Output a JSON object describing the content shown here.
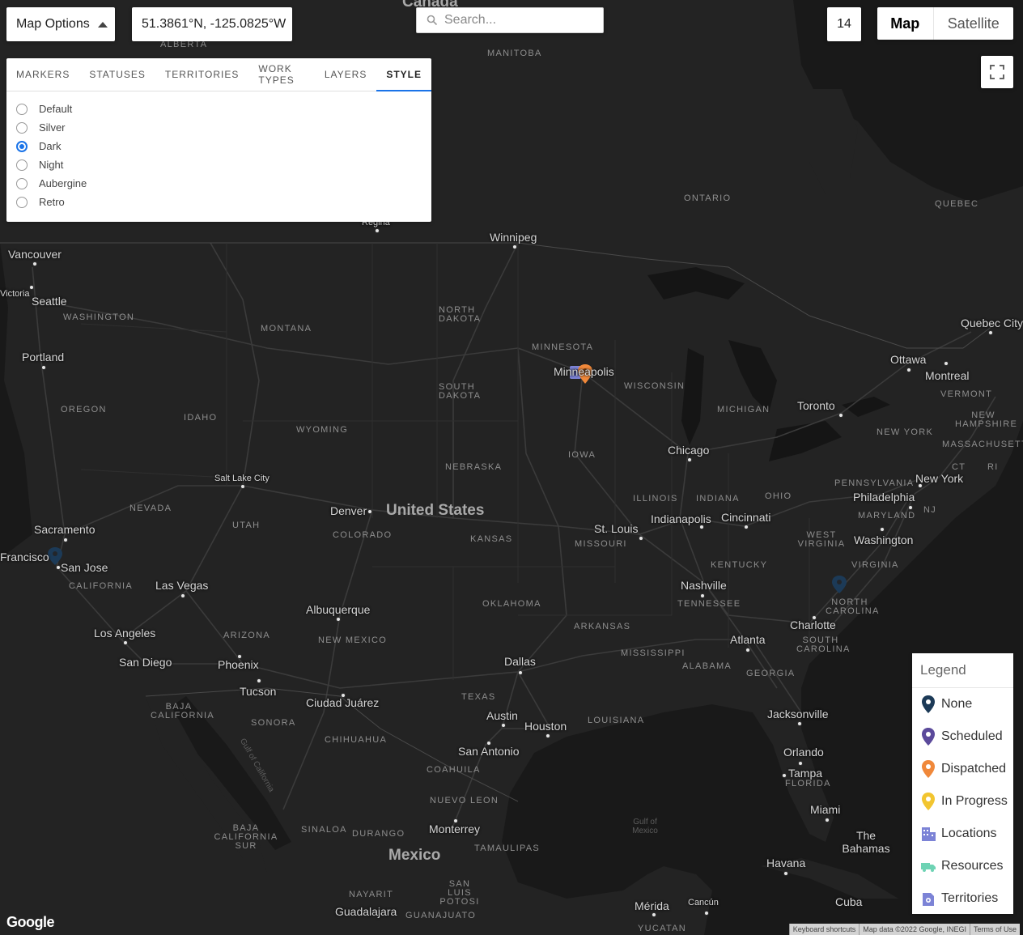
{
  "toolbar": {
    "map_options_label": "Map Options",
    "coordinates": "51.3861°N, -125.0825°W",
    "search_placeholder": "Search...",
    "zoom_level": "14",
    "map_type": {
      "map_label": "Map",
      "satellite_label": "Satellite",
      "selected": "Map"
    }
  },
  "options_panel": {
    "tabs": [
      "MARKERS",
      "STATUSES",
      "TERRITORIES",
      "WORK TYPES",
      "LAYERS",
      "STYLE"
    ],
    "active_tab": "STYLE",
    "styles": [
      "Default",
      "Silver",
      "Dark",
      "Night",
      "Aubergine",
      "Retro"
    ],
    "selected_style": "Dark"
  },
  "legend": {
    "title": "Legend",
    "items": [
      {
        "label": "None",
        "icon": "pin-icon",
        "color": "#1c3a57"
      },
      {
        "label": "Scheduled",
        "icon": "pin-icon",
        "color": "#5b4a9b"
      },
      {
        "label": "Dispatched",
        "icon": "pin-icon",
        "color": "#f0883a"
      },
      {
        "label": "In Progress",
        "icon": "pin-icon",
        "color": "#f2c530"
      },
      {
        "label": "Locations",
        "icon": "building-icon",
        "color": "#7c83d6"
      },
      {
        "label": "Resources",
        "icon": "truck-icon",
        "color": "#6ed3b4"
      },
      {
        "label": "Territories",
        "icon": "territory-icon",
        "color": "#7c83d6"
      }
    ]
  },
  "map": {
    "countries": [
      "Canada",
      "United States",
      "Mexico"
    ],
    "cities": [
      "Vancouver",
      "Victoria",
      "Seattle",
      "Portland",
      "Sacramento",
      "Francisco",
      "San Jose",
      "Las Vegas",
      "Los Angeles",
      "San Diego",
      "Phoenix",
      "Tucson",
      "Ciudad Juárez",
      "Albuquerque",
      "Salt Lake City",
      "Denver",
      "Winnipeg",
      "Regina",
      "Minneapolis",
      "Chicago",
      "St. Louis",
      "Indianapolis",
      "Cincinnati",
      "Nashville",
      "Atlanta",
      "Charlotte",
      "Washington",
      "Philadelphia",
      "New York",
      "Toronto",
      "Ottawa",
      "Montreal",
      "Quebec City",
      "Dallas",
      "Austin",
      "Houston",
      "San Antonio",
      "Monterrey",
      "Jacksonville",
      "Orlando",
      "Tampa",
      "Miami",
      "Havana",
      "Mérida",
      "Cancún",
      "Guadalajara"
    ],
    "states": [
      "ALBERTA",
      "MANITOBA",
      "ONTARIO",
      "QUEBEC",
      "WASHINGTON",
      "MONTANA",
      "NORTH DAKOTA",
      "MINNESOTA",
      "SOUTH DAKOTA",
      "WISCONSIN",
      "OREGON",
      "IDAHO",
      "WYOMING",
      "MICHIGAN",
      "IOWA",
      "NEBRASKA",
      "NEVADA",
      "UTAH",
      "COLORADO",
      "KANSAS",
      "ILLINOIS",
      "INDIANA",
      "OHIO",
      "PENNSYLVANIA",
      "NEW YORK",
      "VERMONT",
      "NEW HAMPSHIRE",
      "MASSACHUSETTS",
      "CT",
      "RI",
      "NJ",
      "MARYLAND",
      "WEST VIRGINIA",
      "VIRGINIA",
      "KENTUCKY",
      "MISSOURI",
      "TENNESSEE",
      "NORTH CAROLINA",
      "SOUTH CAROLINA",
      "CALIFORNIA",
      "ARIZONA",
      "NEW MEXICO",
      "OKLAHOMA",
      "ARKANSAS",
      "MISSISSIPPI",
      "ALABAMA",
      "GEORGIA",
      "TEXAS",
      "LOUISIANA",
      "FLORIDA",
      "BAJA CALIFORNIA",
      "SONORA",
      "CHIHUAHUA",
      "COAHUILA",
      "NUEVO LEON",
      "BAJA CALIFORNIA SUR",
      "SINALOA",
      "DURANGO",
      "TAMAULIPAS",
      "SAN LUIS POTOSI",
      "NAYARIT",
      "YUCATAN",
      "GUANAJUATO"
    ],
    "water": [
      "Gulf of California",
      "Gulf of Mexico",
      "The Bahamas",
      "Cuba"
    ]
  },
  "footer": {
    "logo": "Google",
    "keyboard_shortcuts": "Keyboard shortcuts",
    "map_data": "Map data ©2022 Google, INEGI",
    "terms": "Terms of Use"
  }
}
